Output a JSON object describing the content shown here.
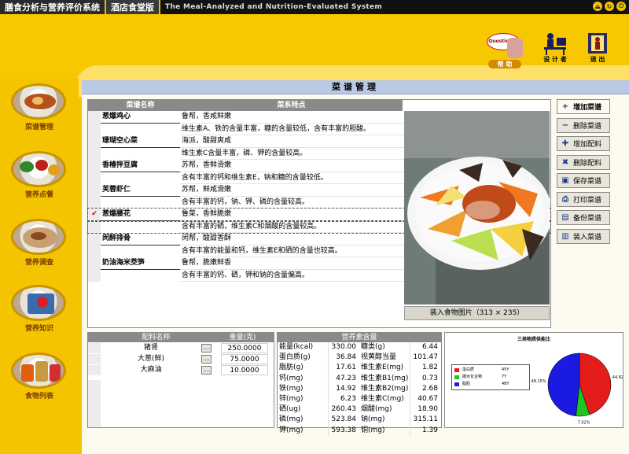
{
  "titlebar": {
    "app_name": "膳食分析与营养评价系统",
    "hotel_name": "酒店食堂版",
    "english_name": "The Meal-Analyzed and Nutrition-Evaluated System",
    "controls": [
      "⏏",
      "↻",
      "⏻"
    ]
  },
  "toolbar": {
    "help_bubble": "Questions?",
    "help_label": "帮 助",
    "designer_label": "设 计 者",
    "exit_label": "退 出"
  },
  "sidebar": [
    {
      "label": "菜谱管理"
    },
    {
      "label": "营养点餐"
    },
    {
      "label": "营养调查"
    },
    {
      "label": "营养知识"
    },
    {
      "label": "食物列表"
    }
  ],
  "main": {
    "title": "菜谱管理",
    "recipe_grid": {
      "col_name": "菜谱名称",
      "col_desc": "菜系特点",
      "rows": [
        {
          "name": "葱爆鸡心",
          "line1": "鲁帮，香咸鲜嫩",
          "line2": "维生素A、铁的含量丰富，糖的含量较低，含有丰富的胆酸。",
          "selected": false
        },
        {
          "name": "珊瑚空心菜",
          "line1": "海派，酸甜爽咸",
          "line2": "维生素C含量丰富，磷、钾的含量较高。",
          "selected": false
        },
        {
          "name": "香椿拌豆腐",
          "line1": "苏帮，香鲜滑嫩",
          "line2": "含有丰富的钙和维生素E，钠和糖的含量较低。",
          "selected": false
        },
        {
          "name": "芙蓉虾仁",
          "line1": "苏帮，鲜咸滑嫩",
          "line2": "含有丰富的钙，钠、钾、磷的含量较高。",
          "selected": false
        },
        {
          "name": "葱爆腰花",
          "line1": "鲁菜，香鲜脆嫩",
          "line2": "含有丰富的硒，维生素C和烟酸的含量较高。",
          "selected": true
        },
        {
          "name": "闵醉排骨",
          "line1": "闵帮，酸甜香酥",
          "line2": "含有丰富的能量和钙，维生素E和硒的含量也较高。",
          "selected": false
        },
        {
          "name": "奶油海米茭笋",
          "line1": "鲁帮，脆嫩鲜香",
          "line2": "含有丰富的钙、硒，钾和钠的含量偏高。",
          "selected": false
        }
      ]
    },
    "selected_mark": "✔",
    "photo_caption": "装入食物图片（313 × 235）",
    "buttons": [
      {
        "icon": "+",
        "label": "增加菜谱"
      },
      {
        "icon": "−",
        "label": "删除菜谱"
      },
      {
        "icon": "✚",
        "label": "增加配料"
      },
      {
        "icon": "✖",
        "label": "删除配料"
      },
      {
        "icon": "▣",
        "label": "保存菜谱"
      },
      {
        "icon": "⎙",
        "label": "打印菜谱"
      },
      {
        "icon": "▤",
        "label": "备份菜谱"
      },
      {
        "icon": "▥",
        "label": "装入菜谱"
      }
    ],
    "ingredients": {
      "col_name": "配料名称",
      "col_weight": "重量(克)",
      "dot_label": "....",
      "rows": [
        {
          "name": "猪肾",
          "weight": "250.0000"
        },
        {
          "name": "大葱(鲜)",
          "weight": "75.0000"
        },
        {
          "name": "大麻油",
          "weight": "10.0000"
        }
      ]
    },
    "nutrients": {
      "title": "营养素含量",
      "left": [
        {
          "label": "能量(kcal)",
          "value": "330.00"
        },
        {
          "label": "蛋白质(g)",
          "value": "36.84"
        },
        {
          "label": "脂肪(g)",
          "value": "17.61"
        },
        {
          "label": "钙(mg)",
          "value": "47.23"
        },
        {
          "label": "铁(mg)",
          "value": "14.92"
        },
        {
          "label": "锌(mg)",
          "value": "6.23"
        },
        {
          "label": "硒(ug)",
          "value": "260.43"
        },
        {
          "label": "磷(mg)",
          "value": "523.84"
        },
        {
          "label": "钾(mg)",
          "value": "593.38"
        }
      ],
      "right": [
        {
          "label": "糖类(g)",
          "value": "6.44"
        },
        {
          "label": "视黄醇当量",
          "value": "101.47"
        },
        {
          "label": "维生素E(mg)",
          "value": "1.82"
        },
        {
          "label": "维生素B1(mg)",
          "value": "0.73"
        },
        {
          "label": "维生素B2(mg)",
          "value": "2.68"
        },
        {
          "label": "维生素C(mg)",
          "value": "40.67"
        },
        {
          "label": "烟酸(mg)",
          "value": "18.90"
        },
        {
          "label": "钠(mg)",
          "value": "315.11"
        },
        {
          "label": "铜(mg)",
          "value": "1.39"
        }
      ]
    }
  },
  "chart_data": {
    "type": "pie",
    "title": "三类物质供能比",
    "series": [
      {
        "name": "蛋白质",
        "value": 44.8,
        "value_label": "44.82%",
        "color": "#e41c1c",
        "legend_value": "45Y"
      },
      {
        "name": "碳水化合物",
        "value": 7.0,
        "value_label": "7.02%",
        "color": "#1fc41f",
        "legend_value": "7Y"
      },
      {
        "name": "脂肪",
        "value": 48.2,
        "value_label": "48.15%",
        "color": "#1a1ae0",
        "legend_value": "48Y"
      }
    ],
    "legend_position": "left"
  },
  "colors": {
    "background": "#f5c400",
    "panel_header": "#8a8a8a",
    "title_band": "#b9c9e6",
    "check": "#d40000"
  }
}
